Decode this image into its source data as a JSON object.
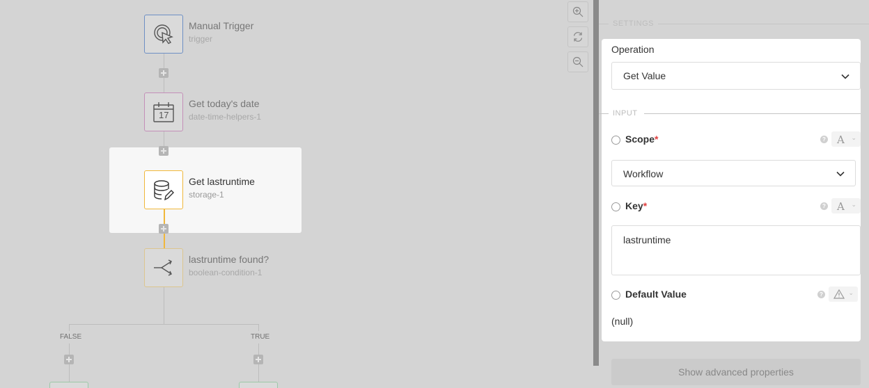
{
  "nodes": [
    {
      "title": "Manual Trigger",
      "subtitle": "trigger",
      "icon": "pointer-click-icon",
      "border": "#6d8fc4"
    },
    {
      "title": "Get today's date",
      "subtitle": "date-time-helpers-1",
      "icon": "calendar-icon",
      "calendar_day": "17",
      "border": "#c48fb8"
    },
    {
      "title": "Get lastruntime",
      "subtitle": "storage-1",
      "icon": "database-edit-icon",
      "border": "#f0b73a",
      "selected": true
    },
    {
      "title": "lastruntime found?",
      "subtitle": "boolean-condition-1",
      "icon": "branch-icon",
      "border": "#dcc58e"
    }
  ],
  "branches": {
    "false_label": "FALSE",
    "true_label": "TRUE"
  },
  "zoom_controls": [
    "zoom-in-icon",
    "reset-zoom-icon",
    "zoom-out-icon"
  ],
  "panel": {
    "settings_header": "SETTINGS",
    "operation_label": "Operation",
    "operation_value": "Get Value",
    "input_header": "INPUT",
    "fields": {
      "scope": {
        "label": "Scope",
        "required": "*",
        "type": "A",
        "value": "Workflow"
      },
      "key": {
        "label": "Key",
        "required": "*",
        "type": "A",
        "value": "lastruntime"
      },
      "default": {
        "label": "Default Value",
        "type_icon": "warning-triangle-icon",
        "value": "(null)"
      }
    },
    "advanced_button": "Show advanced properties"
  },
  "colors": {
    "accent": "#f0b73a",
    "required": "#e04040"
  }
}
